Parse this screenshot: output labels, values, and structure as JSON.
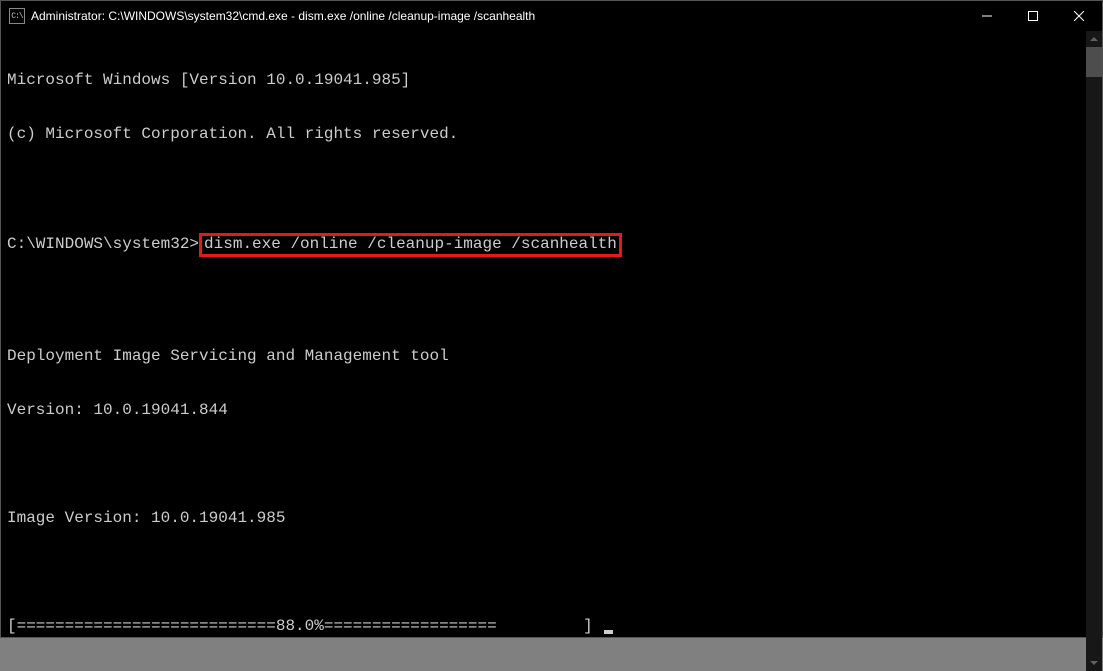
{
  "window": {
    "icon_label": "C:\\",
    "title": "Administrator: C:\\WINDOWS\\system32\\cmd.exe - dism.exe  /online /cleanup-image /scanhealth"
  },
  "terminal": {
    "line1": "Microsoft Windows [Version 10.0.19041.985]",
    "line2": "(c) Microsoft Corporation. All rights reserved.",
    "blank1": "",
    "prompt_prefix": "C:\\WINDOWS\\system32>",
    "command_highlighted": "dism.exe /online /cleanup-image /scanhealth",
    "blank2": "",
    "tool_line1": "Deployment Image Servicing and Management tool",
    "tool_line2": "Version: 10.0.19041.844",
    "blank3": "",
    "img_ver": "Image Version: 10.0.19041.985",
    "blank4": "",
    "progress": "[===========================88.0%==================         ] "
  }
}
